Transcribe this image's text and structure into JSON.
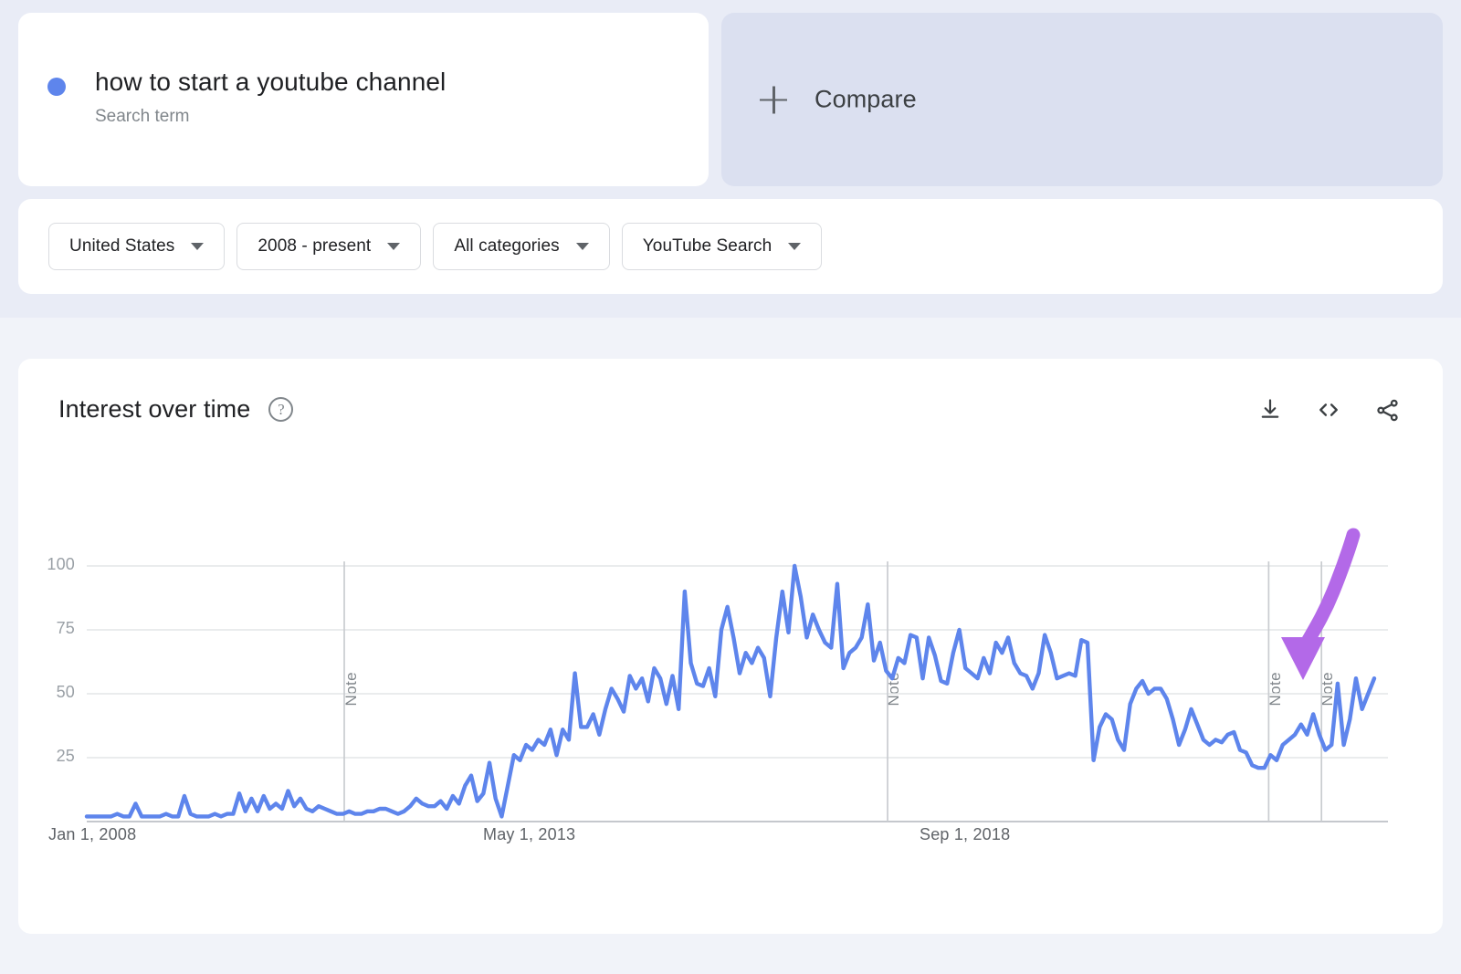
{
  "search_term": {
    "title": "how to start a youtube channel",
    "subtitle": "Search term",
    "dot_color": "#5e85ec"
  },
  "compare": {
    "label": "Compare",
    "plus_icon": "plus-icon",
    "background": "#dbe0f0"
  },
  "filters": [
    {
      "label": "United States",
      "icon": "chevron-down-icon"
    },
    {
      "label": "2008 - present",
      "icon": "chevron-down-icon"
    },
    {
      "label": "All categories",
      "icon": "chevron-down-icon"
    },
    {
      "label": "YouTube Search",
      "icon": "chevron-down-icon"
    }
  ],
  "chart_panel": {
    "title": "Interest over time",
    "help_icon": "?",
    "actions": [
      {
        "name": "download-icon"
      },
      {
        "name": "embed-code-icon"
      },
      {
        "name": "share-icon"
      }
    ]
  },
  "chart_data": {
    "type": "line",
    "title": "Interest over time",
    "xlabel": "",
    "ylabel": "",
    "ylim": [
      0,
      110
    ],
    "y_ticks": [
      100,
      75,
      50,
      25
    ],
    "x_ticks": [
      "Jan 1, 2008",
      "May 1, 2013",
      "Sep 1, 2018"
    ],
    "grid": true,
    "legend_position": "none",
    "series_color": "#5e85ec",
    "annotations": [
      {
        "type": "note-marker",
        "label": "Note",
        "x_fraction": 0.2
      },
      {
        "type": "note-marker",
        "label": "Note",
        "x_fraction": 0.622
      },
      {
        "type": "note-marker",
        "label": "Note",
        "x_fraction": 0.918
      },
      {
        "type": "note-marker",
        "label": "Note",
        "x_fraction": 0.959
      },
      {
        "type": "arrow",
        "color": "#b369e8",
        "points_to": "recent-upswing"
      }
    ],
    "series": [
      {
        "name": "how to start a youtube channel",
        "values": [
          2,
          2,
          2,
          2,
          2,
          3,
          2,
          2,
          7,
          2,
          2,
          2,
          2,
          3,
          2,
          2,
          10,
          3,
          2,
          2,
          2,
          3,
          2,
          3,
          3,
          11,
          4,
          9,
          4,
          10,
          5,
          7,
          5,
          12,
          6,
          9,
          5,
          4,
          6,
          5,
          4,
          3,
          3,
          4,
          3,
          3,
          4,
          4,
          5,
          5,
          4,
          3,
          4,
          6,
          9,
          7,
          6,
          6,
          8,
          5,
          10,
          7,
          14,
          18,
          8,
          11,
          23,
          9,
          2,
          14,
          26,
          24,
          30,
          28,
          32,
          30,
          36,
          26,
          36,
          32,
          58,
          37,
          37,
          42,
          34,
          44,
          52,
          48,
          43,
          57,
          52,
          56,
          47,
          60,
          56,
          46,
          57,
          44,
          90,
          62,
          54,
          53,
          60,
          49,
          75,
          84,
          72,
          58,
          66,
          62,
          68,
          64,
          49,
          72,
          90,
          74,
          100,
          88,
          72,
          81,
          75,
          70,
          68,
          93,
          60,
          66,
          68,
          72,
          85,
          63,
          70,
          59,
          56,
          64,
          62,
          73,
          72,
          56,
          72,
          65,
          55,
          54,
          66,
          75,
          60,
          58,
          56,
          64,
          58,
          70,
          66,
          72,
          62,
          58,
          57,
          52,
          58,
          73,
          66,
          56,
          57,
          58,
          57,
          71,
          70,
          24,
          37,
          42,
          40,
          32,
          28,
          46,
          52,
          55,
          50,
          52,
          52,
          48,
          40,
          30,
          36,
          44,
          38,
          32,
          30,
          32,
          31,
          34,
          35,
          28,
          27,
          22,
          21,
          21,
          26,
          24,
          30,
          32,
          34,
          38,
          34,
          42,
          34,
          28,
          30,
          54,
          30,
          40,
          56,
          44,
          50,
          56
        ]
      }
    ]
  }
}
